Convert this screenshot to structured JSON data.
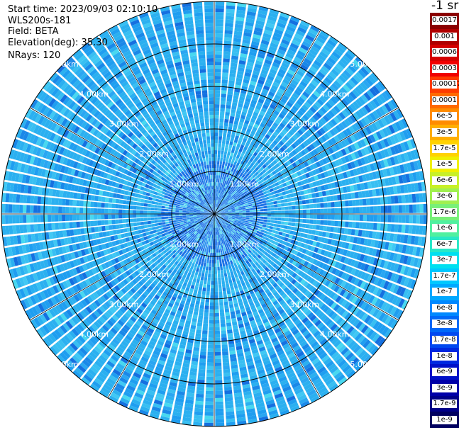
{
  "header": {
    "start_time": "Start time: 2023/09/03 02:10:10",
    "instrument": "WLS200s-181",
    "field": "Field: BETA",
    "elevation": "Elevation(deg): 35.30",
    "nrays": "NRays: 120"
  },
  "units_label": "-1 sr",
  "colorbar": {
    "labels": [
      "0.0017",
      "0.001",
      "0.0006",
      "0.0003",
      "0.00017",
      "0.0001",
      "6e-5",
      "3e-5",
      "1.7e-5",
      "1e-5",
      "6e-6",
      "3e-6",
      "1.7e-6",
      "1e-6",
      "6e-7",
      "3e-7",
      "1.7e-7",
      "1e-7",
      "6e-8",
      "3e-8",
      "1.7e-8",
      "1e-8",
      "6e-9",
      "3e-9",
      "1.7e-9",
      "1e-9"
    ],
    "colors": [
      "#8b0000",
      "#b00000",
      "#d40000",
      "#f00000",
      "#ff3c00",
      "#ff6a00",
      "#ff8c00",
      "#ffae00",
      "#ffd200",
      "#f0f000",
      "#c8f028",
      "#a0f050",
      "#78f078",
      "#50f0a0",
      "#28e8c8",
      "#00e0f0",
      "#00c8ff",
      "#00a8ff",
      "#0088ff",
      "#0068f8",
      "#0048f0",
      "#0028e0",
      "#0010c8",
      "#0000a8",
      "#000088",
      "#000060"
    ]
  },
  "chart_data": {
    "type": "heatmap",
    "projection": "polar PPI",
    "field": "BETA",
    "nrays": 120,
    "elevation_deg": 35.3,
    "max_range_km": 5.0,
    "range_rings": [
      {
        "range_km": 1.0,
        "label": "1.00km"
      },
      {
        "range_km": 2.0,
        "label": "2.00km"
      },
      {
        "range_km": 3.0,
        "label": "3.00km"
      },
      {
        "range_km": 4.0,
        "label": "4.00km"
      },
      {
        "range_km": 5.0,
        "label": "5.00km"
      }
    ],
    "spokes_deg": [
      0,
      30,
      60,
      90,
      120,
      150,
      180,
      210,
      240,
      270,
      300,
      330
    ],
    "ring_label_azimuths_deg": [
      45,
      135,
      225,
      315
    ],
    "background_color": "#2bb0f0",
    "grid": true
  }
}
